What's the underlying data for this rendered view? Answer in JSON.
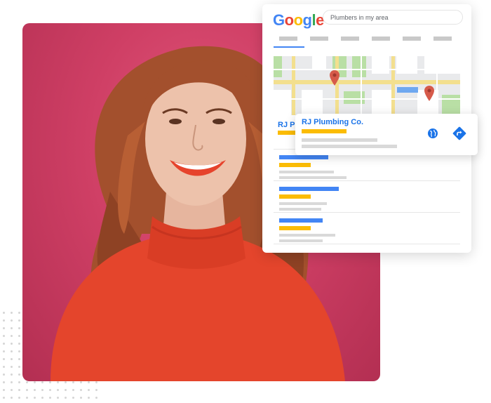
{
  "search": {
    "logo_letters": [
      "G",
      "o",
      "o",
      "g",
      "l",
      "e"
    ],
    "query": "Plumbers in my area"
  },
  "featured_listing": {
    "name": "RJ Plumbing Co.",
    "partial_name": "RJ P"
  },
  "colors": {
    "logo": [
      "#4285f4",
      "#ea4335",
      "#fbbc05",
      "#4285f4",
      "#34a853",
      "#ea4335"
    ],
    "link_blue": "#1a73e8",
    "accent_yellow": "#fbbc05",
    "placeholder_gray": "#d9d9d9",
    "map_green": "#b9dfa5",
    "pin_red": "#d65a4a",
    "photo_background": "#cf3f65",
    "sweater": "#e4452c"
  },
  "icons": [
    "globe-icon",
    "directions-icon",
    "map-pin-icon"
  ]
}
